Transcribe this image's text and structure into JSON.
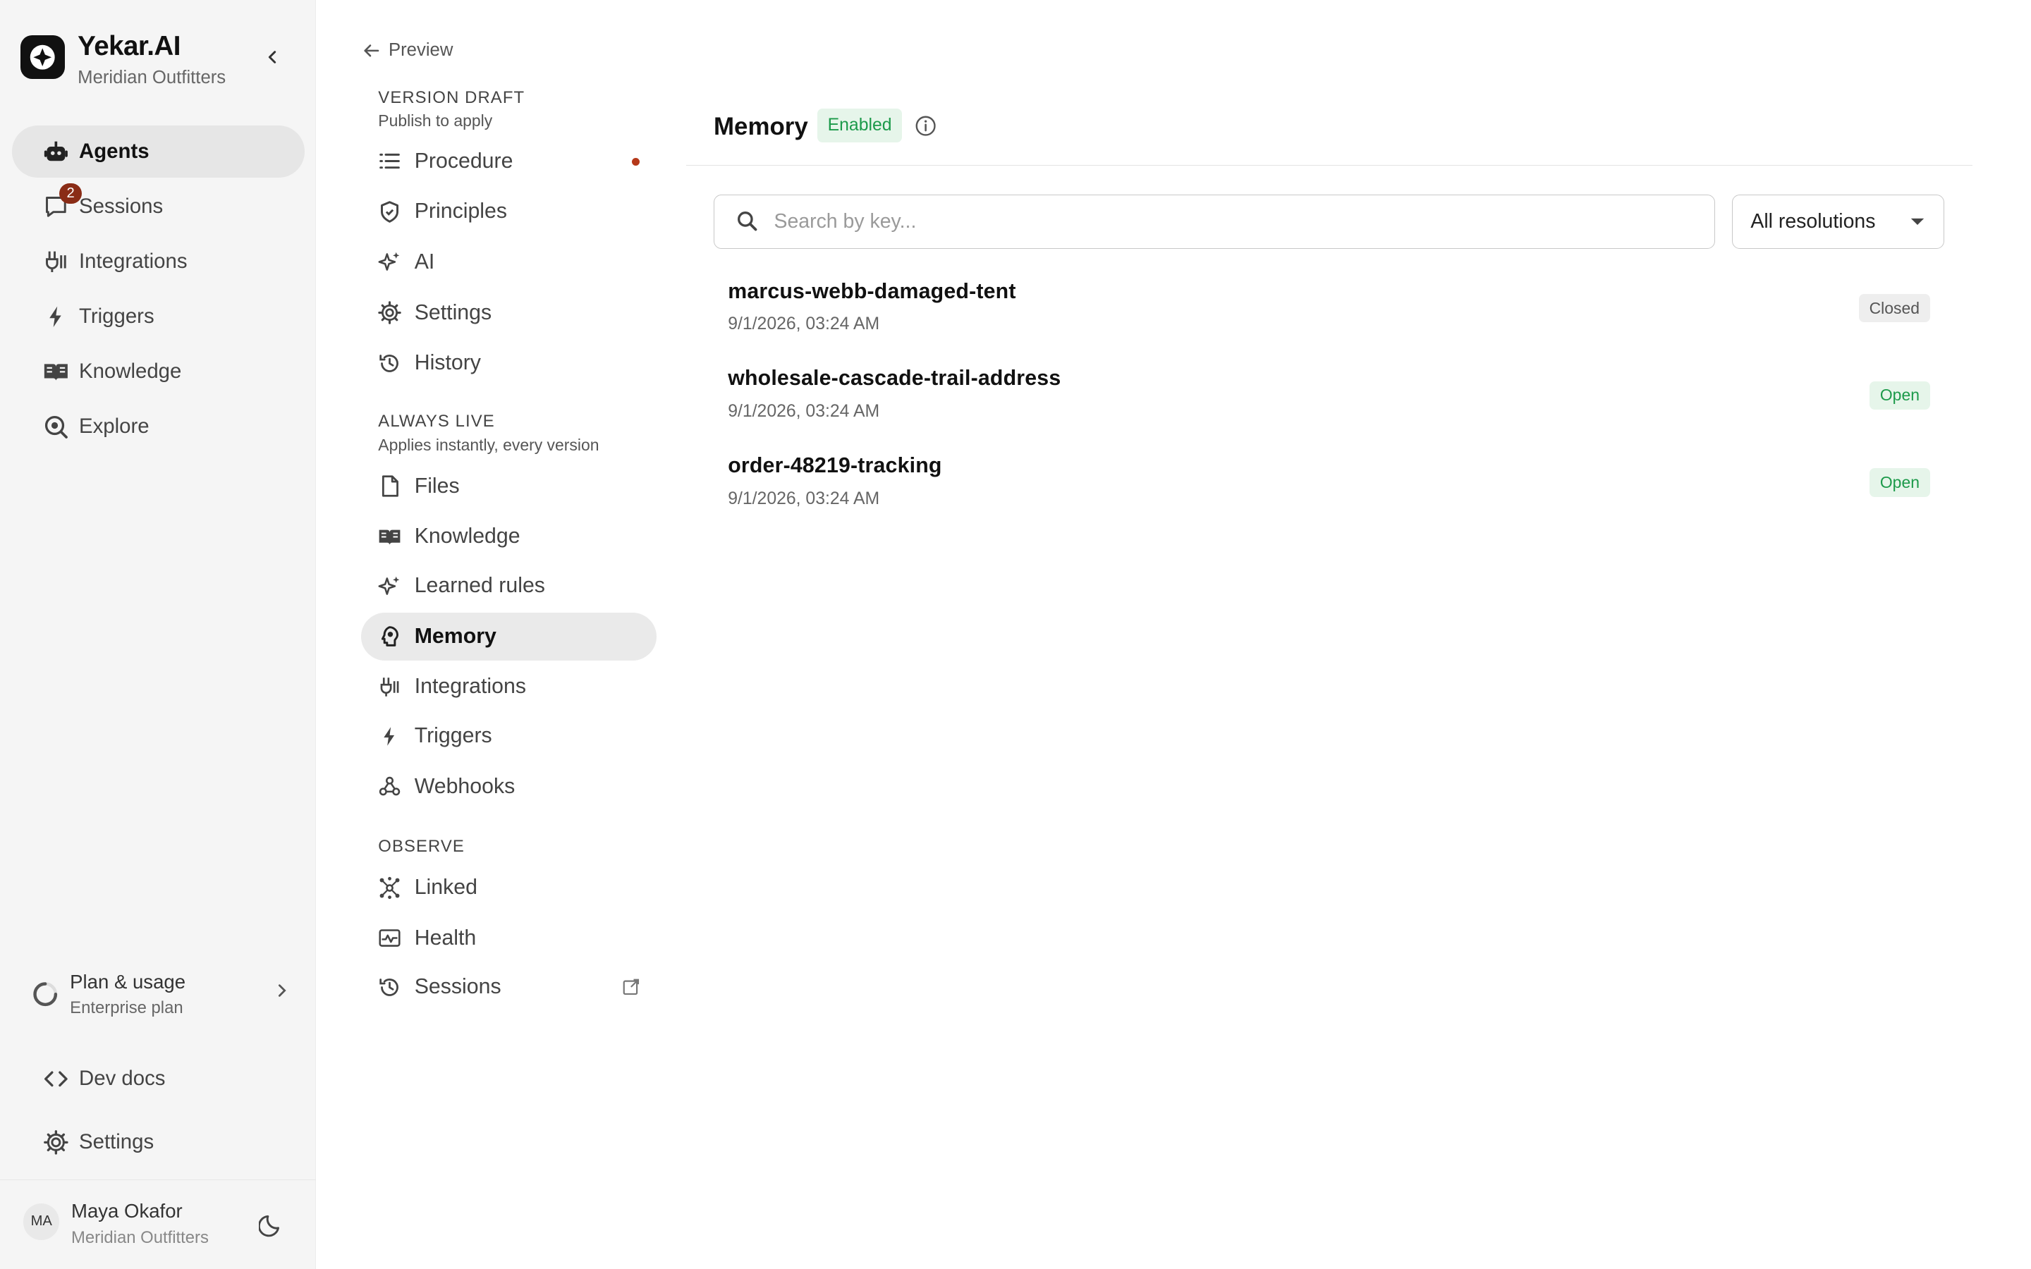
{
  "brand": {
    "name": "Yekar.AI",
    "org": "Meridian Outfitters"
  },
  "sidebar": {
    "items": [
      {
        "label": "Agents",
        "icon": "robot-icon",
        "active": true
      },
      {
        "label": "Sessions",
        "icon": "chat-icon",
        "badge": "2"
      },
      {
        "label": "Integrations",
        "icon": "plug-icon"
      },
      {
        "label": "Triggers",
        "icon": "bolt-icon"
      },
      {
        "label": "Knowledge",
        "icon": "book-icon"
      },
      {
        "label": "Explore",
        "icon": "explore-icon"
      }
    ],
    "plan": {
      "title": "Plan & usage",
      "subtitle": "Enterprise plan"
    },
    "dev_docs": "Dev docs",
    "settings": "Settings"
  },
  "user": {
    "initials": "MA",
    "name": "Maya Okafor",
    "org": "Meridian Outfitters"
  },
  "subnav": {
    "back_label": "Preview",
    "version_draft": {
      "title": "VERSION DRAFT",
      "subtitle": "Publish to apply"
    },
    "draft_items": [
      "Procedure",
      "Principles",
      "AI",
      "Settings",
      "History"
    ],
    "always_live": {
      "title": "ALWAYS LIVE",
      "subtitle": "Applies instantly, every version"
    },
    "live_items": [
      "Files",
      "Knowledge",
      "Learned rules",
      "Memory",
      "Integrations",
      "Triggers",
      "Webhooks"
    ],
    "observe": {
      "title": "OBSERVE"
    },
    "observe_items": [
      "Linked",
      "Health",
      "Sessions"
    ]
  },
  "main": {
    "title": "Memory",
    "status": "Enabled",
    "search_placeholder": "Search by key...",
    "filter_value": "All resolutions",
    "memories": [
      {
        "key": "marcus-webb-damaged-tent",
        "time": "9/1/2026, 03:24 AM",
        "status": "Closed"
      },
      {
        "key": "wholesale-cascade-trail-address",
        "time": "9/1/2026, 03:24 AM",
        "status": "Open"
      },
      {
        "key": "order-48219-tracking",
        "time": "9/1/2026, 03:24 AM",
        "status": "Open"
      }
    ]
  },
  "colors": {
    "accent_green": "#1c9a4a",
    "badge_red": "#8a2c16",
    "dot_red": "#b5391a"
  }
}
